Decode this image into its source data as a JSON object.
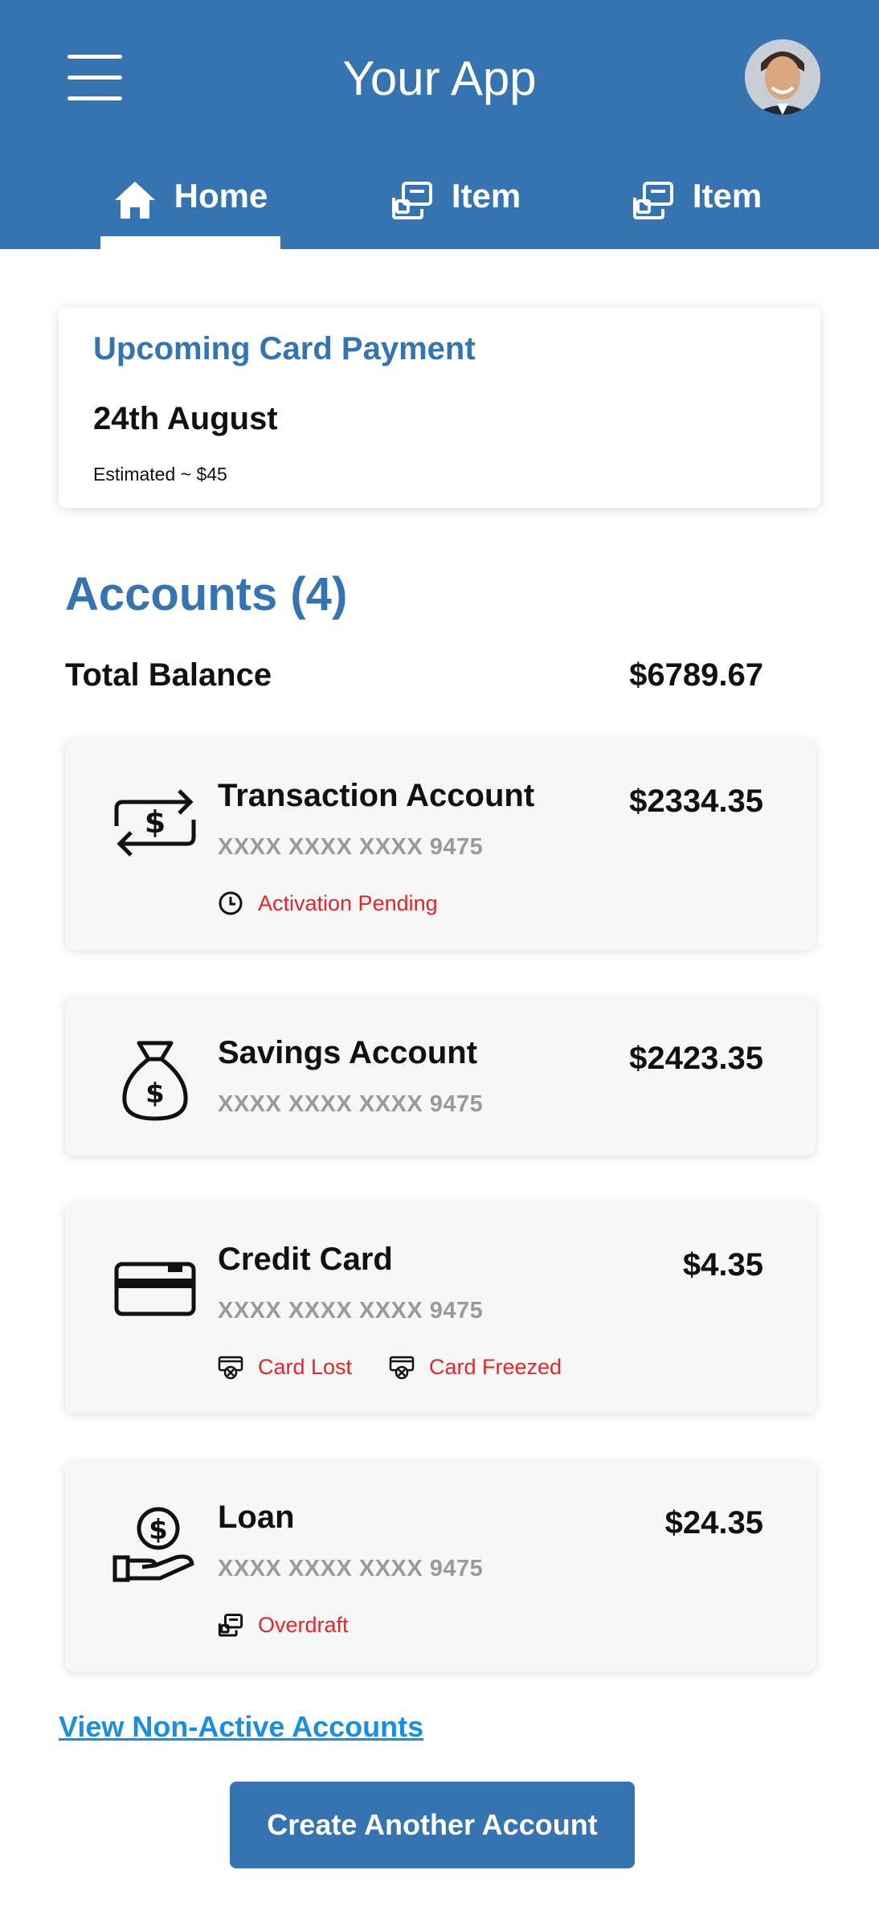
{
  "header": {
    "title": "Your App",
    "menu_icon": "hamburger-menu-icon",
    "avatar_icon": "user-avatar",
    "background_color": "#3674b1"
  },
  "tabs": [
    {
      "label": "Home",
      "icon": "home-icon",
      "active": true
    },
    {
      "label": "Item",
      "icon": "cards-icon",
      "active": false
    },
    {
      "label": "Item",
      "icon": "cards-icon",
      "active": false
    }
  ],
  "upcoming_payment": {
    "title": "Upcoming Card Payment",
    "date": "24th August",
    "estimate": "Estimated ~ $45"
  },
  "accounts": {
    "title": "Accounts (4)",
    "total_label": "Total Balance",
    "total_value": "$6789.67",
    "items": [
      {
        "name": "Transaction Account",
        "number": "XXXX XXXX XXXX 9475",
        "balance": "$2334.35",
        "icon": "transfer-dollar-icon",
        "statuses": [
          {
            "label": "Activation Pending",
            "icon": "clock-icon"
          }
        ]
      },
      {
        "name": "Savings Account",
        "number": "XXXX XXXX XXXX 9475",
        "balance": "$2423.35",
        "icon": "money-bag-icon",
        "statuses": []
      },
      {
        "name": "Credit Card",
        "number": "XXXX XXXX XXXX 9475",
        "balance": "$4.35",
        "icon": "credit-card-icon",
        "statuses": [
          {
            "label": "Card Lost",
            "icon": "card-blocked-icon"
          },
          {
            "label": "Card Freezed",
            "icon": "card-blocked-icon"
          }
        ]
      },
      {
        "name": "Loan",
        "number": "XXXX XXXX XXXX 9475",
        "balance": "$24.35",
        "icon": "hand-coin-icon",
        "statuses": [
          {
            "label": "Overdraft",
            "icon": "cards-icon"
          }
        ]
      }
    ]
  },
  "view_non_active_label": "View Non-Active Accounts",
  "create_account_label": "Create Another Account",
  "colors": {
    "primary": "#3674b1",
    "status_red": "#e3262b",
    "link_blue": "#1a8fe0"
  }
}
